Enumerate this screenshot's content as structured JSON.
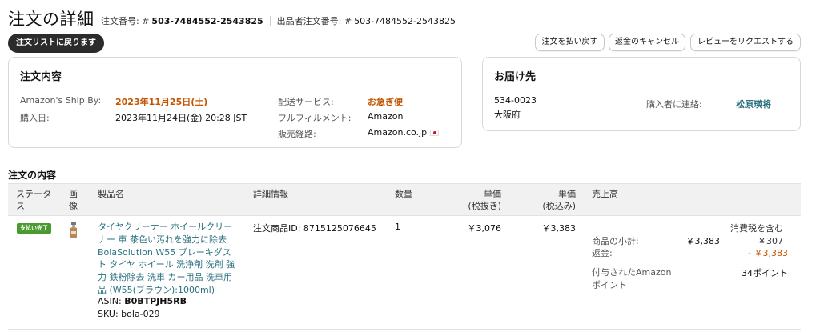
{
  "header": {
    "title": "注文の詳細",
    "order_number_label": "注文番号: #",
    "order_number": "503-7484552-2543825",
    "seller_order_label": "出品者注文番号: #",
    "seller_order_number": "503-7484552-2543825",
    "back_button": "注文リストに戻ります",
    "actions": [
      "注文を払い戻す",
      "返金のキャンセル",
      "レビューをリクエストする"
    ]
  },
  "order_card": {
    "title": "注文内容",
    "ship_by_label": "Amazon's Ship By:",
    "ship_by_value": "2023年11月25日(土)",
    "purchase_date_label": "購入日:",
    "purchase_date_value": "2023年11月24日(金) 20:28 JST",
    "shipping_service_label": "配送サービス:",
    "shipping_service_value": "お急ぎ便",
    "fulfillment_label": "フルフィルメント:",
    "fulfillment_value": "Amazon",
    "channel_label": "販売経路:",
    "channel_value": "Amazon.co.jp"
  },
  "ship_card": {
    "title": "お届け先",
    "postal_code": "534-0023",
    "prefecture": "大阪府",
    "contact_label": "購入者に連絡:",
    "contact_name": "松原瑛将"
  },
  "items": {
    "section_title": "注文の内容",
    "columns": {
      "status": "ステータス",
      "image": "画像",
      "product": "製品名",
      "details": "詳細情報",
      "qty": "数量",
      "unit_price_ex_line1": "単価",
      "unit_price_ex_line2": "(税抜き)",
      "unit_price_in_line1": "単価",
      "unit_price_in_line2": "(税込み)",
      "sales": "売上高"
    },
    "row": {
      "status": "支払い完了",
      "product_name": "タイヤクリーナー ホイールクリーナー 車 茶色い汚れを強力に除去 BolaSolution W55 ブレーキダスト タイヤ ホイール 洗浄剤 洗剤 強力 鉄粉除去 洗車 カー用品 洗車用品 (W55(ブラウン):1000ml)",
      "asin_label": "ASIN:",
      "asin": "B0BTPJH5RB",
      "sku_label": "SKU:",
      "sku": "bola-029",
      "order_item_id_label": "注文商品ID:",
      "order_item_id": "8715125076645",
      "qty": "1",
      "unit_price_ex": "￥3,076",
      "unit_price_in": "￥3,383",
      "tax_included_label": "消費税を含む",
      "subtotal_label": "商品の小計:",
      "subtotal_value": "￥3,383",
      "subtotal_tax": "￥307",
      "refund_label": "返金:",
      "refund_value": "- ￥3,383",
      "points_label": "付与されたAmazonポイント",
      "points_value": "34ポイント"
    }
  }
}
